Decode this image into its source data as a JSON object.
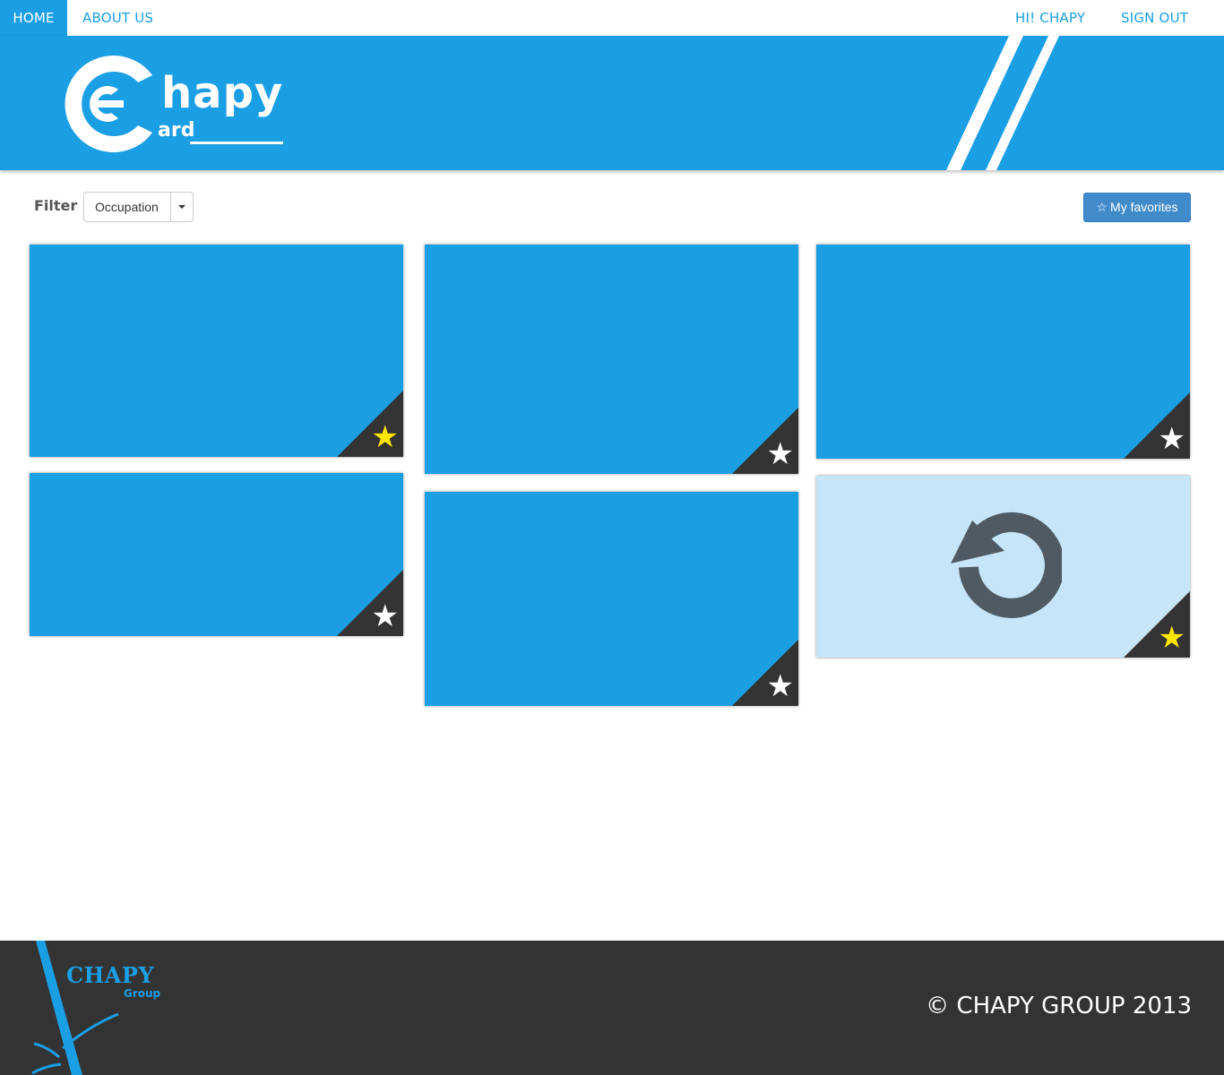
{
  "nav": {
    "home": "HOME",
    "about": "ABOUT US",
    "greeting": "HI! CHAPY",
    "signout": "SIGN OUT"
  },
  "logo": {
    "word_main": "hapy",
    "word_sub": "ard"
  },
  "filter": {
    "label": "Filter",
    "selected": "Occupation"
  },
  "favorites_button": {
    "icon": "star-outline-icon",
    "label": "My favorites"
  },
  "colors": {
    "brand_blue": "#1a9ee4",
    "dark": "#333333",
    "star_active": "#ffe600",
    "flipped_card": "#c6e5f8"
  },
  "cards": [
    {
      "favorite": true,
      "state": "front"
    },
    {
      "favorite": false,
      "state": "front"
    },
    {
      "favorite": false,
      "state": "front"
    },
    {
      "favorite": false,
      "state": "front"
    },
    {
      "favorite": false,
      "state": "front"
    },
    {
      "favorite": true,
      "state": "flipped",
      "icon": "refresh-icon"
    }
  ],
  "footer": {
    "brand_name": "CHAPY",
    "brand_sub": "Group",
    "copyright": "© CHAPY GROUP 2013"
  }
}
